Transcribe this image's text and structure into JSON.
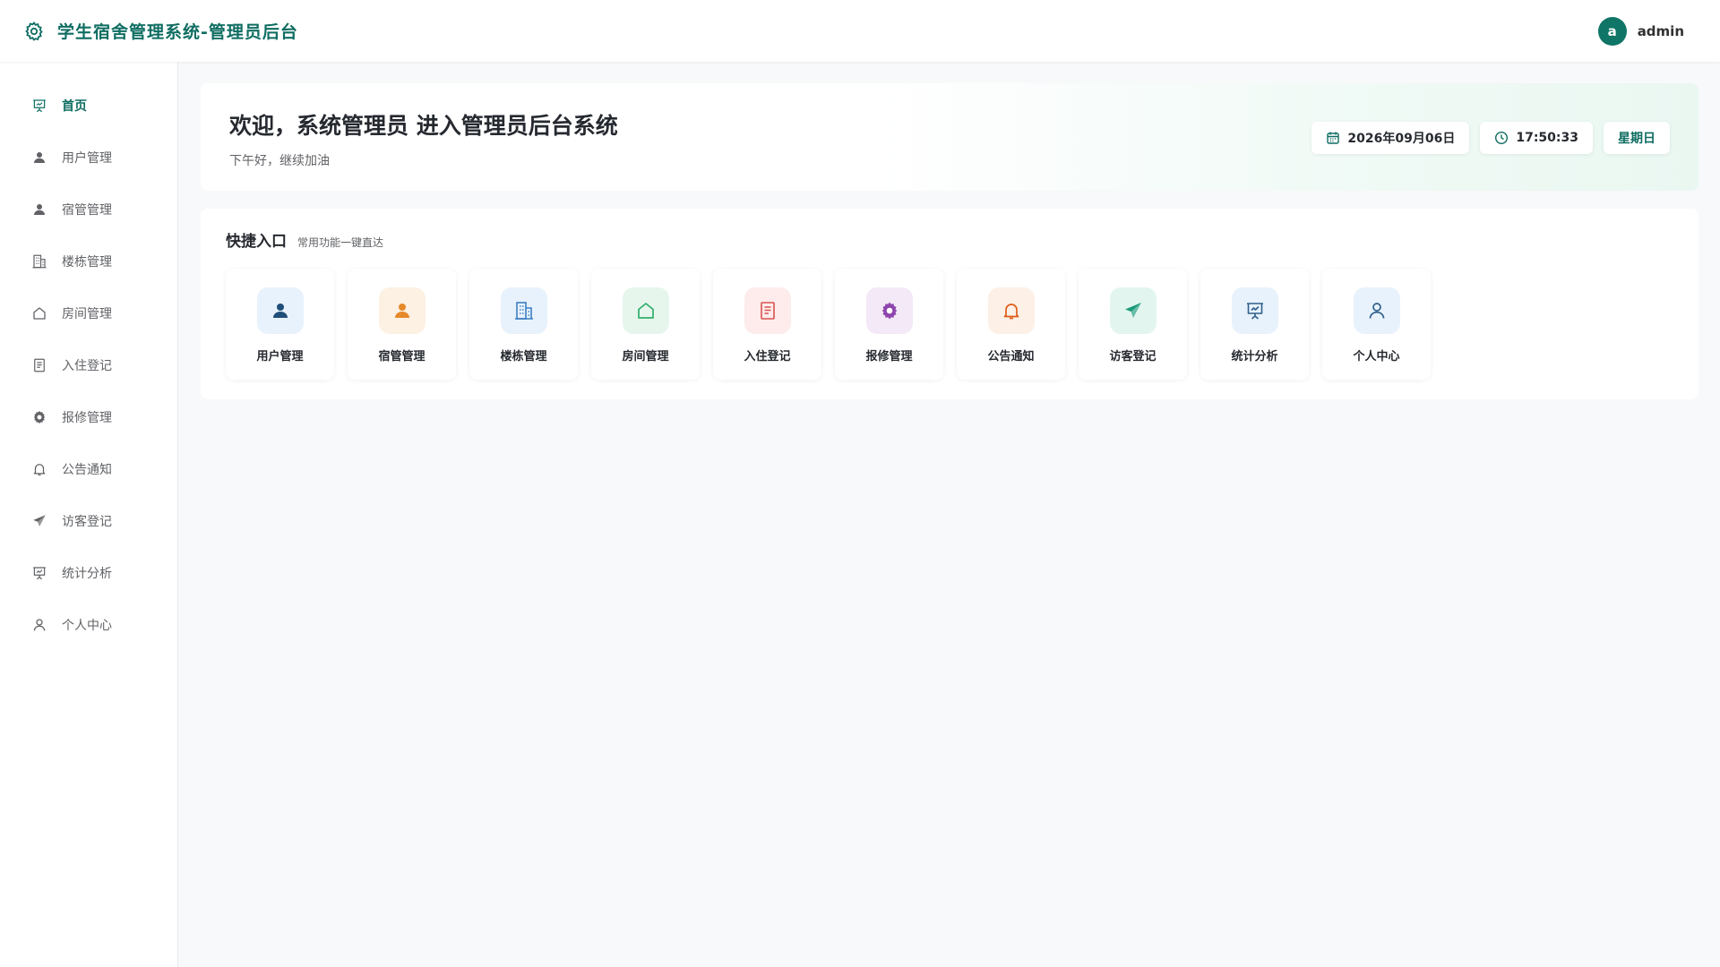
{
  "header": {
    "title": "学生宿舍管理系统-管理员后台",
    "brand_icon": "gear-icon",
    "user": {
      "avatar_letter": "a",
      "name": "admin"
    }
  },
  "sidebar": {
    "items": [
      {
        "label": "首页",
        "icon": "presentation-chart-icon",
        "active": true
      },
      {
        "label": "用户管理",
        "icon": "user-icon"
      },
      {
        "label": "宿管管理",
        "icon": "user-icon"
      },
      {
        "label": "楼栋管理",
        "icon": "building-icon"
      },
      {
        "label": "房间管理",
        "icon": "house-icon"
      },
      {
        "label": "入住登记",
        "icon": "document-icon"
      },
      {
        "label": "报修管理",
        "icon": "settings-icon"
      },
      {
        "label": "公告通知",
        "icon": "bell-icon"
      },
      {
        "label": "访客登记",
        "icon": "send-icon"
      },
      {
        "label": "统计分析",
        "icon": "presentation-chart-icon"
      },
      {
        "label": "个人中心",
        "icon": "user-outline-icon"
      }
    ]
  },
  "welcome": {
    "title": "欢迎，系统管理员 进入管理员后台系统",
    "subtitle": "下午好，继续加油",
    "date": "2026年09月06日",
    "time": "17:50:33",
    "weekday": "星期日"
  },
  "quick": {
    "title": "快捷入口",
    "subtitle": "常用功能一键直达",
    "items": [
      {
        "label": "用户管理",
        "icon": "user-icon",
        "color": "#1f4e79",
        "bg": "#e8f2fc"
      },
      {
        "label": "宿管管理",
        "icon": "user-icon",
        "color": "#e6892b",
        "bg": "#fdf1e3"
      },
      {
        "label": "楼栋管理",
        "icon": "building-icon",
        "color": "#3d7fc1",
        "bg": "#e8f2fc"
      },
      {
        "label": "房间管理",
        "icon": "house-icon",
        "color": "#2fae6a",
        "bg": "#e6f6ed"
      },
      {
        "label": "入住登记",
        "icon": "document-icon",
        "color": "#d9534f",
        "bg": "#fdeceb"
      },
      {
        "label": "报修管理",
        "icon": "settings-icon",
        "color": "#8e44ad",
        "bg": "#f3e9f7"
      },
      {
        "label": "公告通知",
        "icon": "bell-icon",
        "color": "#e05d1a",
        "bg": "#fdf0e6"
      },
      {
        "label": "访客登记",
        "icon": "send-icon",
        "color": "#1a9a7a",
        "bg": "#e3f5ef"
      },
      {
        "label": "统计分析",
        "icon": "presentation-chart-icon",
        "color": "#2d5f8a",
        "bg": "#e8f2fc"
      },
      {
        "label": "个人中心",
        "icon": "user-outline-icon",
        "color": "#2d5f8a",
        "bg": "#e8f2fc"
      }
    ]
  },
  "colors": {
    "accent": "#0f6d62",
    "background": "#f7f9fb"
  }
}
